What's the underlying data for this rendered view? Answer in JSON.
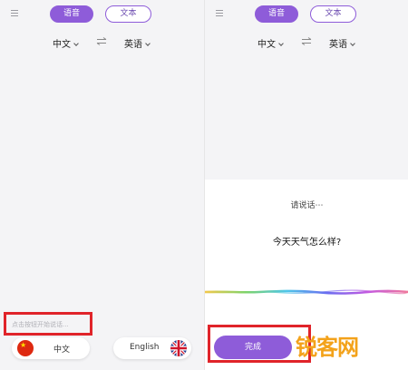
{
  "tabs": {
    "voice": "语音",
    "text": "文本"
  },
  "languages": {
    "source": "中文",
    "target": "英语"
  },
  "left": {
    "input_placeholder": "点击按钮开始说话...",
    "pill_source": "中文",
    "pill_target": "English"
  },
  "right": {
    "prompt": "请说话⋯",
    "spoken_text": "今天天气怎么样?",
    "done_label": "完成",
    "watermark": "锐客网"
  },
  "icons": {
    "menu": "hamburger-menu-icon",
    "swap": "swap-arrows-icon",
    "chevron": "chevron-down-icon",
    "flag_cn": "china-flag-icon",
    "flag_uk": "uk-flag-icon"
  },
  "colors": {
    "accent": "#8e5cd9",
    "highlight_box": "#e0242a",
    "watermark": "#f3a21a"
  }
}
